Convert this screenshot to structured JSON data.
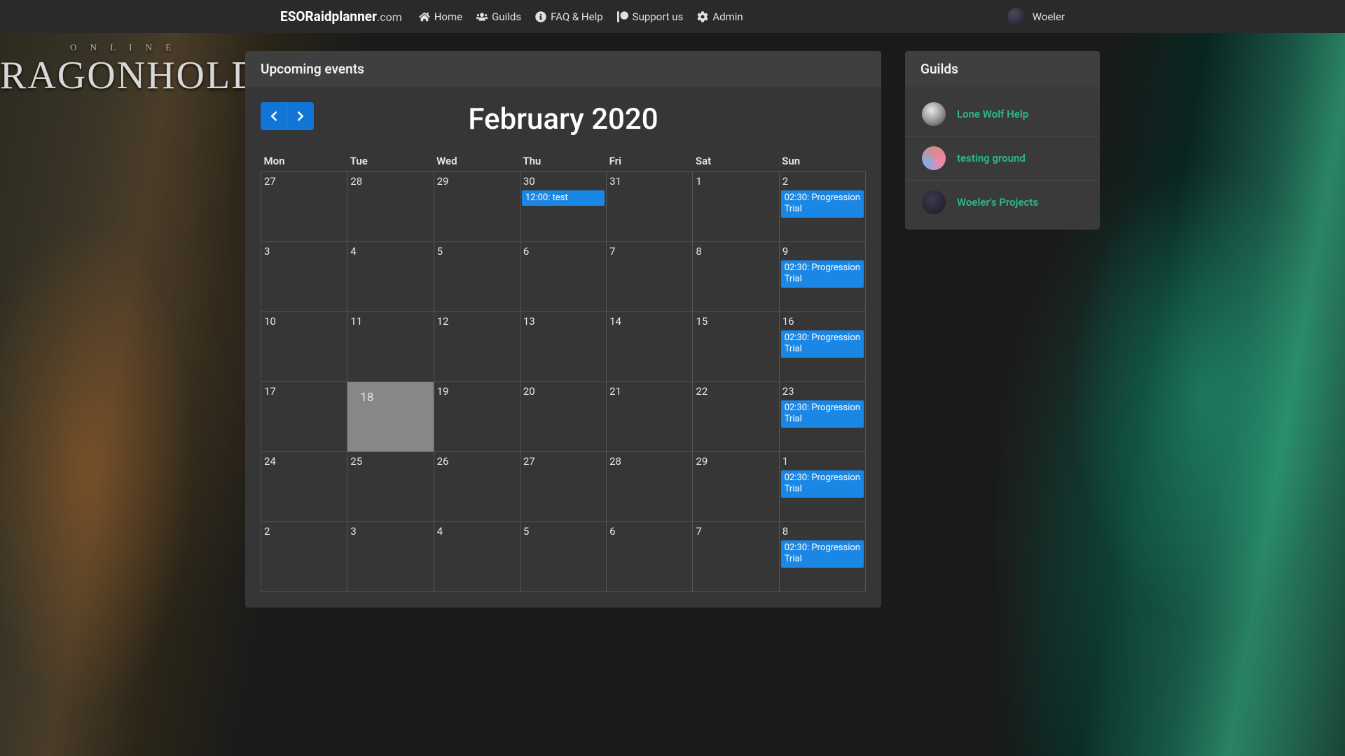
{
  "brand": {
    "name": "ESORaidplanner",
    "tld": ".com"
  },
  "nav": {
    "home": "Home",
    "guilds": "Guilds",
    "faq": "FAQ & Help",
    "support": "Support us",
    "admin": "Admin"
  },
  "user": {
    "name": "Woeler"
  },
  "bg": {
    "small": "O N L I N E",
    "big": "RAGONHOLD"
  },
  "panels": {
    "upcoming": "Upcoming events",
    "guilds": "Guilds"
  },
  "calendar": {
    "title": "February 2020",
    "weekdays": [
      "Mon",
      "Tue",
      "Wed",
      "Thu",
      "Fri",
      "Sat",
      "Sun"
    ],
    "weeks": [
      [
        {
          "num": "27"
        },
        {
          "num": "28"
        },
        {
          "num": "29"
        },
        {
          "num": "30",
          "events": [
            {
              "label": "12:00: test"
            }
          ]
        },
        {
          "num": "31"
        },
        {
          "num": "1"
        },
        {
          "num": "2",
          "events": [
            {
              "label": "02:30: Progression Trial"
            }
          ]
        }
      ],
      [
        {
          "num": "3"
        },
        {
          "num": "4"
        },
        {
          "num": "5"
        },
        {
          "num": "6"
        },
        {
          "num": "7"
        },
        {
          "num": "8"
        },
        {
          "num": "9",
          "events": [
            {
              "label": "02:30: Progression Trial"
            }
          ]
        }
      ],
      [
        {
          "num": "10"
        },
        {
          "num": "11"
        },
        {
          "num": "12"
        },
        {
          "num": "13"
        },
        {
          "num": "14"
        },
        {
          "num": "15"
        },
        {
          "num": "16",
          "events": [
            {
              "label": "02:30: Progression Trial"
            }
          ]
        }
      ],
      [
        {
          "num": "17"
        },
        {
          "num": "18",
          "today": true
        },
        {
          "num": "19"
        },
        {
          "num": "20"
        },
        {
          "num": "21"
        },
        {
          "num": "22"
        },
        {
          "num": "23",
          "events": [
            {
              "label": "02:30: Progression Trial"
            }
          ]
        }
      ],
      [
        {
          "num": "24"
        },
        {
          "num": "25"
        },
        {
          "num": "26"
        },
        {
          "num": "27"
        },
        {
          "num": "28"
        },
        {
          "num": "29"
        },
        {
          "num": "1",
          "events": [
            {
              "label": "02:30: Progression Trial"
            }
          ]
        }
      ],
      [
        {
          "num": "2"
        },
        {
          "num": "3"
        },
        {
          "num": "4"
        },
        {
          "num": "5"
        },
        {
          "num": "6"
        },
        {
          "num": "7"
        },
        {
          "num": "8",
          "events": [
            {
              "label": "02:30: Progression Trial"
            }
          ]
        }
      ]
    ]
  },
  "guilds": [
    {
      "name": "Lone Wolf Help",
      "avatarClass": "ga1"
    },
    {
      "name": "testing ground",
      "avatarClass": "ga2"
    },
    {
      "name": "Woeler's Projects",
      "avatarClass": "ga3"
    }
  ]
}
